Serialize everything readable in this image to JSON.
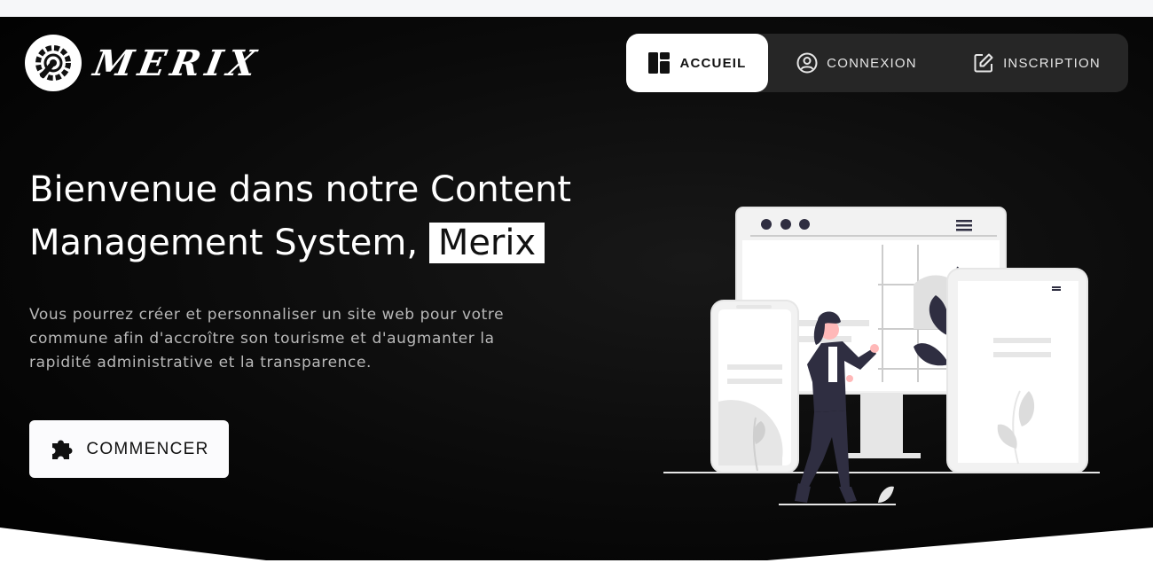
{
  "brand": {
    "name": "MERIX",
    "logo_icon": "wrench-gear-icon"
  },
  "nav": {
    "items": [
      {
        "label": "ACCUEIL",
        "icon": "dashboard-icon",
        "active": true
      },
      {
        "label": "CONNEXION",
        "icon": "user-circle-icon",
        "active": false
      },
      {
        "label": "INSCRIPTION",
        "icon": "edit-icon",
        "active": false
      }
    ]
  },
  "hero": {
    "title_line1": "Bienvenue dans notre Content",
    "title_line2": "Management System,",
    "title_highlight": "Merix",
    "subtitle": "Vous pourrez créer et personnaliser un site web pour votre commune afin d'accroître son tourisme et d'augmanter la rapidité administrative et la transparence.",
    "cta_label": "COMMENCER",
    "cta_icon": "puzzle-icon"
  },
  "colors": {
    "background": "#0a0a0a",
    "accent": "#ffffff",
    "illustration_dark": "#2f2e41"
  }
}
